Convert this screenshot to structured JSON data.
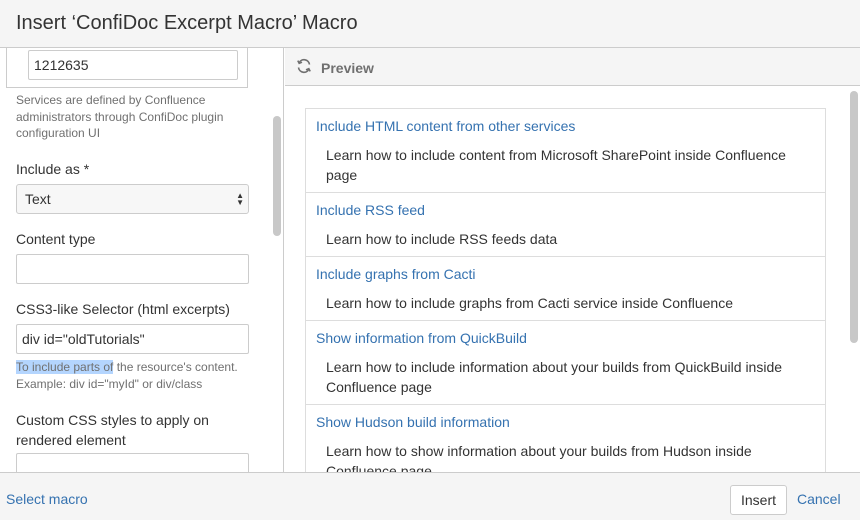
{
  "dialog": {
    "title": "Insert ‘ConfiDoc Excerpt Macro’ Macro"
  },
  "form": {
    "service_id_value": "1212635",
    "service_help": [
      "Services are defined by Confluence",
      "administrators through ConfiDoc plugin",
      "configuration UI"
    ],
    "include_as_label": "Include as *",
    "include_as_value": "Text",
    "content_type_label": "Content type",
    "content_type_value": "",
    "selector_label": "CSS3-like Selector (html excerpts)",
    "selector_value": "div id=\"oldTutorials\"",
    "selector_help_highlight": "To include parts of",
    "selector_help_rest": " the resource's content.",
    "selector_help_line2": "Example: div id=\"myId\" or div/class",
    "custom_css_label_line1": "Custom CSS styles to apply on",
    "custom_css_label_line2": "rendered element",
    "custom_css_value": ""
  },
  "preview": {
    "title": "Preview",
    "items": [
      {
        "title": "Include HTML content from other services",
        "desc": "Learn how to include content from Microsoft SharePoint inside Confluence page"
      },
      {
        "title": "Include RSS feed",
        "desc": "Learn how to include RSS feeds data"
      },
      {
        "title": "Include graphs from Cacti",
        "desc": "Learn how to include graphs from Cacti service inside Confluence"
      },
      {
        "title": "Show information from QuickBuild",
        "desc": "Learn how to include information about your builds from QuickBuild inside Confluence page"
      },
      {
        "title": "Show Hudson build information",
        "desc": "Learn how to show information about your builds from Hudson inside Confluence page"
      }
    ]
  },
  "footer": {
    "select_macro": "Select macro",
    "insert": "Insert",
    "cancel": "Cancel"
  },
  "colors": {
    "link": "#3572b0",
    "highlight": "#b4d5fe"
  }
}
